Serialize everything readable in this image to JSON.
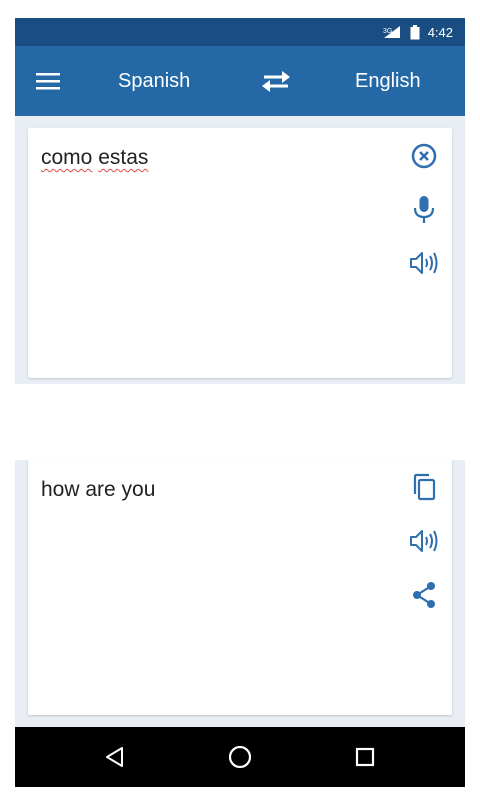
{
  "status_bar": {
    "network": "3G",
    "time": "4:42"
  },
  "app_bar": {
    "source_language": "Spanish",
    "target_language": "English"
  },
  "input_card": {
    "text_words": [
      "como",
      "estas"
    ],
    "icons": [
      "clear-icon",
      "microphone-icon",
      "speaker-icon"
    ]
  },
  "output_card": {
    "text": "how are you",
    "icons": [
      "copy-icon",
      "speaker-icon",
      "share-icon"
    ]
  },
  "nav_bar": {
    "icons": [
      "back-icon",
      "home-icon",
      "recents-icon"
    ]
  },
  "colors": {
    "status_bar": "#1a4e83",
    "app_bar": "#2468a6",
    "accent_icon": "#2e6fae",
    "section_bg": "#e8eef4",
    "spellcheck_underline": "#e04848"
  }
}
